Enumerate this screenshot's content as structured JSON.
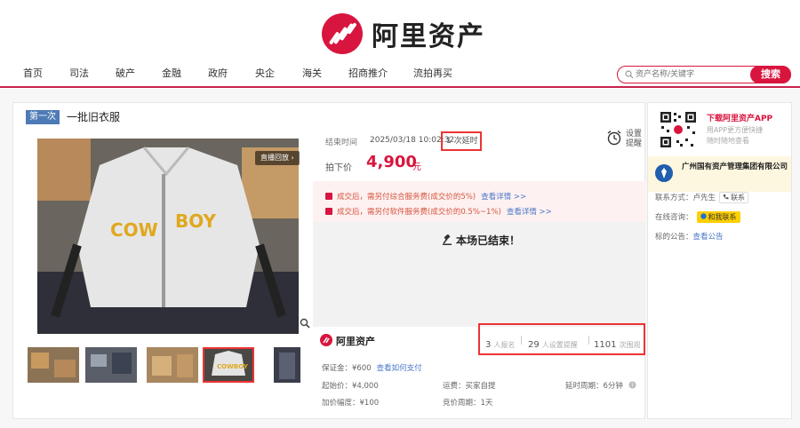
{
  "brand": {
    "name": "阿里资产"
  },
  "nav": {
    "items": [
      "首页",
      "司法",
      "破产",
      "金融",
      "政府",
      "央企",
      "海关",
      "招商推介",
      "流拍再买"
    ]
  },
  "search": {
    "placeholder": "资产名称/关键字",
    "button": "搜索"
  },
  "lot": {
    "round": "第一次",
    "title": "一批旧衣服",
    "live_label": "直播回放 ›",
    "end_label": "结束时间",
    "end_time": "2025/03/18 10:02:32",
    "delay": "1 次延时",
    "remind": [
      "设置",
      "提醒"
    ],
    "price_label": "拍下价",
    "price": "4,900",
    "price_unit": "元",
    "fees": [
      {
        "text": "成交后，需另付综合服务费(成交价的5%)",
        "link": "查看详情 >>"
      },
      {
        "text": "成交后，需另付软件服务费(成交价的0.5%~1%)",
        "link": "查看详情 >>"
      }
    ],
    "ended": "本场已结束！",
    "platform": "阿里资产",
    "stats": [
      {
        "num": "3",
        "label": "人报名"
      },
      {
        "num": "29",
        "label": "人设置提醒"
      },
      {
        "num": "1101",
        "label": "次围观"
      }
    ],
    "deposit": "保证金：¥600",
    "deposit_link": "查看如何支付",
    "start_price": "起始价：¥4,000",
    "increment": "加价幅度：¥100",
    "shipping": "运费：买家自提",
    "cycle": "竞价周期：1天",
    "delay_period": "延时周期：6分钟"
  },
  "side": {
    "app_title": "下载阿里资产APP",
    "app_desc": [
      "用APP更方便快捷",
      "随时随地查看"
    ],
    "org": "广州国有资产管理集团有限公司",
    "contact_label": "联系方式：",
    "contact_name": "卢先生",
    "contact_btn": "联系",
    "online_label": "在线咨询：",
    "online_btn": "和我联系",
    "notice_label": "标的公告：",
    "notice_link": "查看公告"
  },
  "colors": {
    "brand": "#d8153e",
    "link": "#4a78c8",
    "highlight_box": "#ee3333"
  }
}
